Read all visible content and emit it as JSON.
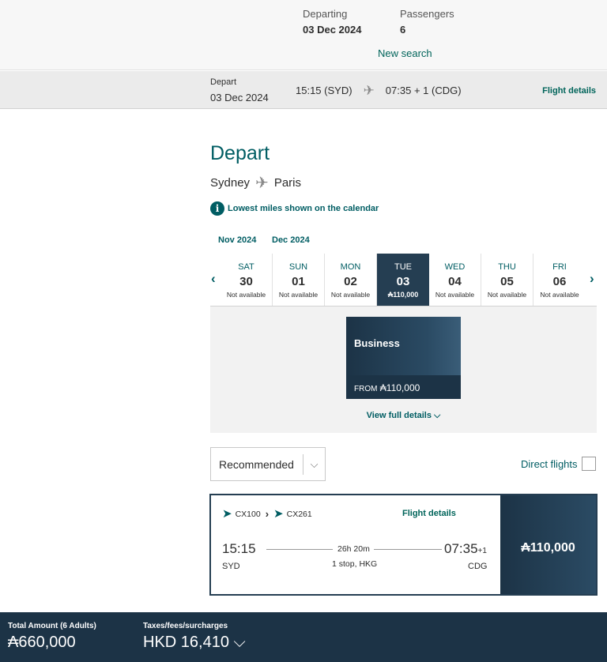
{
  "summary": {
    "departing_label": "Departing",
    "departing_value": "03 Dec 2024",
    "passengers_label": "Passengers",
    "passengers_value": "6",
    "new_search": "New search"
  },
  "depart_bar": {
    "label": "Depart",
    "date": "03 Dec 2024",
    "dep": "15:15 (SYD)",
    "arr": "07:35 + 1 (CDG)",
    "flight_details": "Flight details",
    "plane_glyph": "✈"
  },
  "page": {
    "title": "Depart",
    "origin": "Sydney",
    "destination": "Paris",
    "info_icon": "i",
    "info_note": "Lowest miles shown on the calendar"
  },
  "months": [
    "Nov 2024",
    "Dec 2024"
  ],
  "calendar": {
    "prev": "‹",
    "next": "›",
    "days": [
      {
        "dow": "SAT",
        "num": "30",
        "status": "Not available"
      },
      {
        "dow": "SUN",
        "num": "01",
        "status": "Not available"
      },
      {
        "dow": "MON",
        "num": "02",
        "status": "Not available"
      },
      {
        "dow": "TUE",
        "num": "03",
        "status": "₳110,000"
      },
      {
        "dow": "WED",
        "num": "04",
        "status": "Not available"
      },
      {
        "dow": "THU",
        "num": "05",
        "status": "Not available"
      },
      {
        "dow": "FRI",
        "num": "06",
        "status": "Not available"
      }
    ]
  },
  "fare": {
    "cabin": "Business",
    "from_label": "FROM",
    "from_price": "₳110,000",
    "view_full": "View full details ⌵"
  },
  "sort": {
    "value": "Recommended",
    "caret": "⌵"
  },
  "direct": {
    "label": "Direct flights"
  },
  "flight": {
    "first": "CX100",
    "second": "CX261",
    "connector": "›",
    "details": "Flight details",
    "dep_time": "15:15",
    "dep_code": "SYD",
    "duration": "26h 20m",
    "stops": "1 stop, HKG",
    "arr_time": "07:35",
    "arr_offset": "+1",
    "arr_code": "CDG",
    "price": "₳110,000"
  },
  "footer": {
    "total_label": "Total Amount (6 Adults)",
    "total_value": "₳660,000",
    "taxes_label": "Taxes/fees/surcharges",
    "taxes_value": "HKD 16,410 ⌵"
  },
  "colors": {
    "accent": "#005d63",
    "navy": "#1c3346",
    "selected_day": "#253e52"
  }
}
